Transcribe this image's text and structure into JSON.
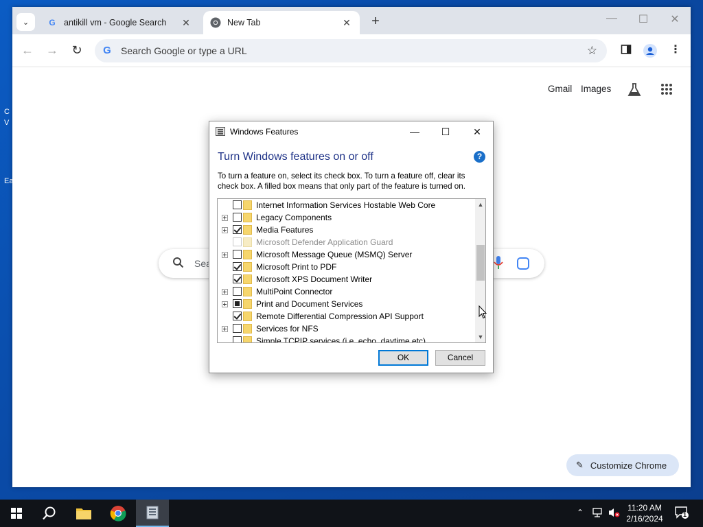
{
  "desktop": {
    "fragments": [
      "C",
      "V",
      "Ea"
    ]
  },
  "chrome": {
    "tabs": [
      {
        "title": "antikill vm - Google Search",
        "favicon": "google-g-icon",
        "active": false
      },
      {
        "title": "New Tab",
        "favicon": "chrome-icon",
        "active": true
      }
    ],
    "new_tab_symbol": "+",
    "omnibox_placeholder": "Search Google or type a URL",
    "page": {
      "gmail_link": "Gmail",
      "images_link": "Images",
      "search_placeholder_visible": "Sea",
      "customize_label": "Customize Chrome"
    }
  },
  "dialog": {
    "window_title": "Windows Features",
    "heading": "Turn Windows features on or off",
    "description": "To turn a feature on, select its check box. To turn a feature off, clear its check box. A filled box means that only part of the feature is turned on.",
    "features": [
      {
        "label": "Internet Information Services Hostable Web Core",
        "state": "unchecked",
        "expandable": false,
        "disabled": false
      },
      {
        "label": "Legacy Components",
        "state": "unchecked",
        "expandable": true,
        "disabled": false
      },
      {
        "label": "Media Features",
        "state": "checked",
        "expandable": true,
        "disabled": false
      },
      {
        "label": "Microsoft Defender Application Guard",
        "state": "unchecked",
        "expandable": false,
        "disabled": true
      },
      {
        "label": "Microsoft Message Queue (MSMQ) Server",
        "state": "unchecked",
        "expandable": true,
        "disabled": false
      },
      {
        "label": "Microsoft Print to PDF",
        "state": "checked",
        "expandable": false,
        "disabled": false
      },
      {
        "label": "Microsoft XPS Document Writer",
        "state": "checked",
        "expandable": false,
        "disabled": false
      },
      {
        "label": "MultiPoint Connector",
        "state": "unchecked",
        "expandable": true,
        "disabled": false
      },
      {
        "label": "Print and Document Services",
        "state": "partial",
        "expandable": true,
        "disabled": false
      },
      {
        "label": "Remote Differential Compression API Support",
        "state": "checked",
        "expandable": false,
        "disabled": false
      },
      {
        "label": "Services for NFS",
        "state": "unchecked",
        "expandable": true,
        "disabled": false
      },
      {
        "label": "Simple TCPIP services (i.e. echo, daytime etc)",
        "state": "unchecked",
        "expandable": false,
        "disabled": false
      }
    ],
    "ok_label": "OK",
    "cancel_label": "Cancel"
  },
  "taskbar": {
    "pinned": [
      "start-icon",
      "search-icon",
      "file-explorer-icon",
      "chrome-icon",
      "windows-features-icon"
    ],
    "time": "11:20 AM",
    "date": "2/16/2024",
    "notification_count": "1"
  }
}
